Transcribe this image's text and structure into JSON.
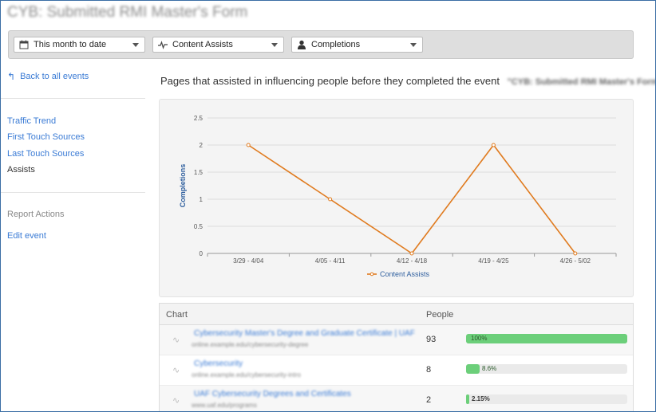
{
  "page_title": "CYB: Submitted RMI Master's Form",
  "toolbar": {
    "date_range": "This month to date",
    "metric": "Content Assists",
    "goal": "Completions"
  },
  "sidebar": {
    "back_label": "Back to all events",
    "nav_items": [
      "Traffic Trend",
      "First Touch Sources",
      "Last Touch Sources",
      "Assists"
    ],
    "active_item": "Assists",
    "report_actions_label": "Report Actions",
    "edit_label": "Edit event"
  },
  "main": {
    "heading": "Pages that assisted in influencing people before they completed the event",
    "event_name": "\"CYB: Submitted RMI Master's Form\""
  },
  "chart_data": {
    "type": "line",
    "categories": [
      "3/29 - 4/04",
      "4/05 - 4/11",
      "4/12 - 4/18",
      "4/19 - 4/25",
      "4/26 - 5/02"
    ],
    "series": [
      {
        "name": "Content Assists",
        "values": [
          2,
          1,
          0,
          2,
          0
        ],
        "color": "#e07b1f"
      }
    ],
    "ylabel": "Completions",
    "xlabel": "",
    "ylim": [
      0,
      2.5
    ],
    "yticks": [
      "0",
      "0.5",
      "1",
      "1.5",
      "2",
      "2.5"
    ],
    "grid": true,
    "legend": "bottom"
  },
  "table": {
    "headers": [
      "Chart",
      "People"
    ],
    "rows": [
      {
        "name": "Cybersecurity Master's Degree and Graduate Certificate | UAF",
        "sub": "online.example.edu/cybersecurity-degree",
        "people": "93",
        "percent": "100%",
        "fraction": 1.0
      },
      {
        "name": "Cybersecurity",
        "sub": "online.example.edu/cybersecurity-intro",
        "people": "8",
        "percent": "8.6%",
        "fraction": 0.086
      },
      {
        "name": "UAF Cybersecurity Degrees and Certificates",
        "sub": "www.uaf.edu/programs",
        "people": "2",
        "percent": "2.15%",
        "fraction": 0.0215
      }
    ]
  },
  "colors": {
    "accent": "#3a7bd5",
    "line": "#e07b1f",
    "bar": "#6ccf7a"
  }
}
